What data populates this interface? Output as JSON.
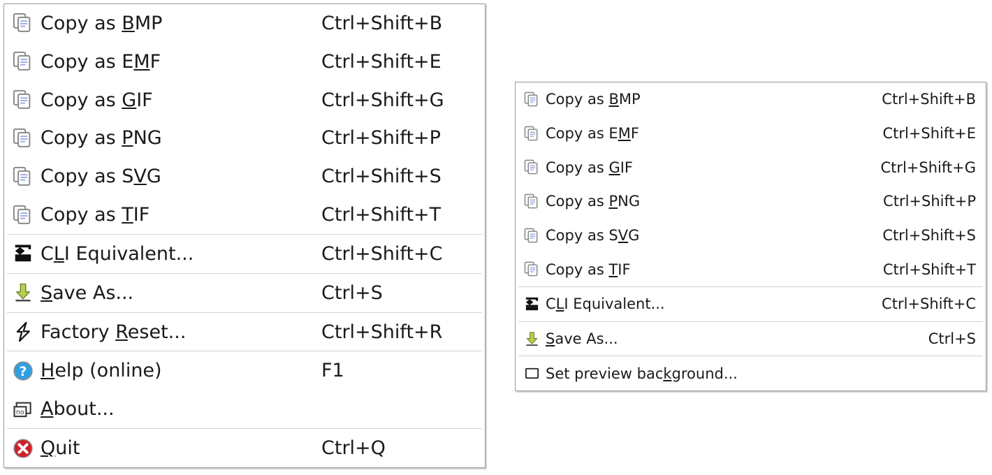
{
  "colors": {
    "menu_background": "#ffffff",
    "menu_border": "#9a9a9a",
    "separator": "#d2d2d2",
    "text": "#1a1a1a",
    "help_icon_blue": "#2f9fe0",
    "quit_icon_red": "#d01f29",
    "save_arrow_green": "#b5d14a",
    "copy_icon_outline": "#8a8a8a",
    "copy_icon_lines": "#9aa8e0",
    "cli_icon_black": "#101010"
  },
  "menus": {
    "left": {
      "name": "application-context-menu-full",
      "items": [
        {
          "type": "item",
          "icon": "copy-icon",
          "label_prefix": "Copy as ",
          "label_mnemonic": "B",
          "label_suffix": "MP",
          "label": "Copy as BMP",
          "accel": "Ctrl+Shift+B"
        },
        {
          "type": "item",
          "icon": "copy-icon",
          "label_prefix": "Copy as E",
          "label_mnemonic": "M",
          "label_suffix": "F",
          "label": "Copy as EMF",
          "accel": "Ctrl+Shift+E"
        },
        {
          "type": "item",
          "icon": "copy-icon",
          "label_prefix": "Copy as ",
          "label_mnemonic": "G",
          "label_suffix": "IF",
          "label": "Copy as GIF",
          "accel": "Ctrl+Shift+G"
        },
        {
          "type": "item",
          "icon": "copy-icon",
          "label_prefix": "Copy as ",
          "label_mnemonic": "P",
          "label_suffix": "NG",
          "label": "Copy as PNG",
          "accel": "Ctrl+Shift+P"
        },
        {
          "type": "item",
          "icon": "copy-icon",
          "label_prefix": "Copy as S",
          "label_mnemonic": "V",
          "label_suffix": "G",
          "label": "Copy as SVG",
          "accel": "Ctrl+Shift+S"
        },
        {
          "type": "item",
          "icon": "copy-icon",
          "label_prefix": "Copy as ",
          "label_mnemonic": "T",
          "label_suffix": "IF",
          "label": "Copy as TIF",
          "accel": "Ctrl+Shift+T"
        },
        {
          "type": "separator"
        },
        {
          "type": "item",
          "icon": "cli-terminal-icon",
          "label_prefix": "C",
          "label_mnemonic": "L",
          "label_suffix": "I Equivalent...",
          "label": "CLI Equivalent...",
          "accel": "Ctrl+Shift+C"
        },
        {
          "type": "separator"
        },
        {
          "type": "item",
          "icon": "save-download-icon",
          "label_prefix": "",
          "label_mnemonic": "S",
          "label_suffix": "ave As...",
          "label": "Save As...",
          "accel": "Ctrl+S"
        },
        {
          "type": "separator"
        },
        {
          "type": "item",
          "icon": "lightning-bolt-icon",
          "label_prefix": "Factory ",
          "label_mnemonic": "R",
          "label_suffix": "eset...",
          "label": "Factory Reset...",
          "accel": "Ctrl+Shift+R"
        },
        {
          "type": "separator"
        },
        {
          "type": "item",
          "icon": "help-circle-icon",
          "label_prefix": "",
          "label_mnemonic": "H",
          "label_suffix": "elp (online)",
          "label": "Help (online)",
          "accel": "F1"
        },
        {
          "type": "item",
          "icon": "about-window-icon",
          "label_prefix": "",
          "label_mnemonic": "A",
          "label_suffix": "bout...",
          "label": "About...",
          "accel": ""
        },
        {
          "type": "separator"
        },
        {
          "type": "item",
          "icon": "quit-circle-icon",
          "label_prefix": "",
          "label_mnemonic": "Q",
          "label_suffix": "uit",
          "label": "Quit",
          "accel": "Ctrl+Q"
        }
      ]
    },
    "right": {
      "name": "preview-context-menu-compact",
      "items": [
        {
          "type": "item",
          "icon": "copy-icon",
          "label_prefix": "Copy as ",
          "label_mnemonic": "B",
          "label_suffix": "MP",
          "label": "Copy as BMP",
          "accel": "Ctrl+Shift+B"
        },
        {
          "type": "item",
          "icon": "copy-icon",
          "label_prefix": "Copy as E",
          "label_mnemonic": "M",
          "label_suffix": "F",
          "label": "Copy as EMF",
          "accel": "Ctrl+Shift+E"
        },
        {
          "type": "item",
          "icon": "copy-icon",
          "label_prefix": "Copy as ",
          "label_mnemonic": "G",
          "label_suffix": "IF",
          "label": "Copy as GIF",
          "accel": "Ctrl+Shift+G"
        },
        {
          "type": "item",
          "icon": "copy-icon",
          "label_prefix": "Copy as ",
          "label_mnemonic": "P",
          "label_suffix": "NG",
          "label": "Copy as PNG",
          "accel": "Ctrl+Shift+P"
        },
        {
          "type": "item",
          "icon": "copy-icon",
          "label_prefix": "Copy as S",
          "label_mnemonic": "V",
          "label_suffix": "G",
          "label": "Copy as SVG",
          "accel": "Ctrl+Shift+S"
        },
        {
          "type": "item",
          "icon": "copy-icon",
          "label_prefix": "Copy as ",
          "label_mnemonic": "T",
          "label_suffix": "IF",
          "label": "Copy as TIF",
          "accel": "Ctrl+Shift+T"
        },
        {
          "type": "separator"
        },
        {
          "type": "item",
          "icon": "cli-terminal-icon",
          "label_prefix": "C",
          "label_mnemonic": "L",
          "label_suffix": "I Equivalent...",
          "label": "CLI Equivalent...",
          "accel": "Ctrl+Shift+C"
        },
        {
          "type": "separator"
        },
        {
          "type": "item",
          "icon": "save-download-icon",
          "label_prefix": "",
          "label_mnemonic": "S",
          "label_suffix": "ave As...",
          "label": "Save As...",
          "accel": "Ctrl+S"
        },
        {
          "type": "separator"
        },
        {
          "type": "item",
          "icon": "square-outline-icon",
          "label_prefix": "Set preview bac",
          "label_mnemonic": "k",
          "label_suffix": "ground...",
          "label": "Set preview background...",
          "accel": ""
        }
      ]
    }
  }
}
